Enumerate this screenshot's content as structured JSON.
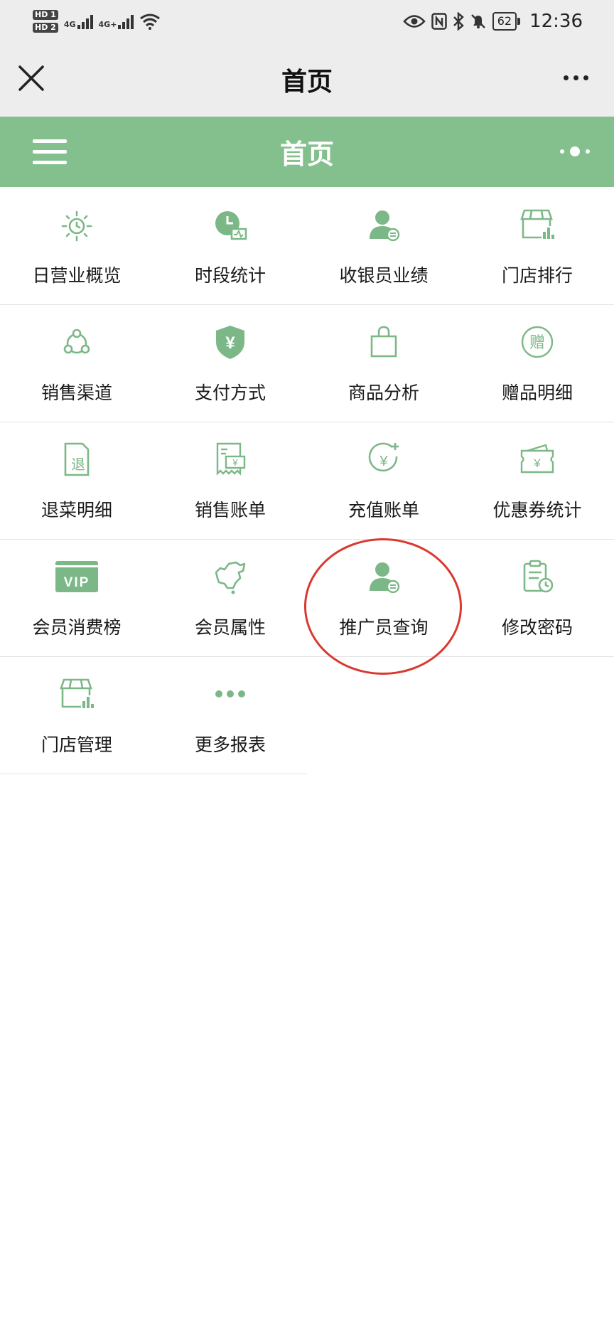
{
  "status_bar": {
    "hd1": "HD 1",
    "hd2": "HD 2",
    "net1": "4G",
    "net2": "4G+",
    "battery": "62",
    "time": "12:36"
  },
  "nav": {
    "title": "首页"
  },
  "app_header": {
    "title": "首页"
  },
  "accent_color": "#84c08d",
  "icon_color": "#7cb887",
  "annotation_color": "#d93a30",
  "grid": [
    {
      "label": "日营业概览",
      "icon": "sun-icon"
    },
    {
      "label": "时段统计",
      "icon": "clock-chart-icon"
    },
    {
      "label": "收银员业绩",
      "icon": "user-badge-icon"
    },
    {
      "label": "门店排行",
      "icon": "store-chart-icon"
    },
    {
      "label": "销售渠道",
      "icon": "channel-nodes-icon"
    },
    {
      "label": "支付方式",
      "icon": "yen-shield-icon"
    },
    {
      "label": "商品分析",
      "icon": "shopping-bag-icon"
    },
    {
      "label": "赠品明细",
      "icon": "gift-char-icon"
    },
    {
      "label": "退菜明细",
      "icon": "return-doc-icon"
    },
    {
      "label": "销售账单",
      "icon": "receipt-icon"
    },
    {
      "label": "充值账单",
      "icon": "recharge-yen-icon"
    },
    {
      "label": "优惠券统计",
      "icon": "coupon-icon"
    },
    {
      "label": "会员消费榜",
      "icon": "vip-card-icon",
      "text": "VIP"
    },
    {
      "label": "会员属性",
      "icon": "china-map-icon"
    },
    {
      "label": "推广员查询",
      "icon": "user-badge-icon"
    },
    {
      "label": "修改密码",
      "icon": "clipboard-clock-icon"
    },
    {
      "label": "门店管理",
      "icon": "store-chart-icon"
    },
    {
      "label": "更多报表",
      "icon": "more-dots-icon"
    }
  ],
  "gift_char": "赠",
  "return_char": "退",
  "yen": "¥"
}
